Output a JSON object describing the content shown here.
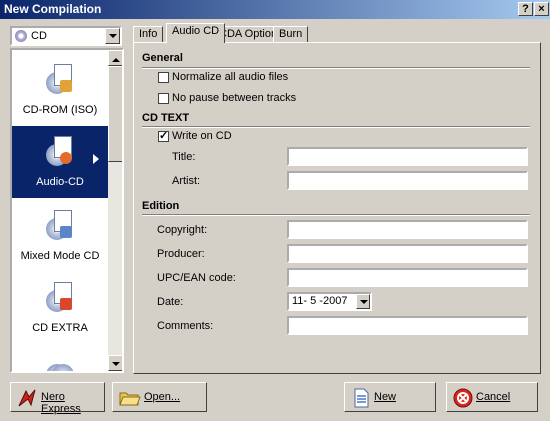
{
  "window": {
    "title": "New Compilation",
    "help_glyph": "?",
    "close_glyph": "×"
  },
  "dropdown": {
    "value": "CD",
    "icon": "cd-icon"
  },
  "types": [
    {
      "label": "CD-ROM (ISO)",
      "icon": "cdrom-iso-icon",
      "selected": false
    },
    {
      "label": "Audio-CD",
      "icon": "audio-cd-icon",
      "selected": true
    },
    {
      "label": "Mixed Mode CD",
      "icon": "mixed-mode-cd-icon",
      "selected": false
    },
    {
      "label": "CD EXTRA",
      "icon": "cd-extra-icon",
      "selected": false
    },
    {
      "label": "",
      "icon": "more-cd-icon",
      "selected": false
    }
  ],
  "tabs": [
    {
      "label": "Info",
      "active": false
    },
    {
      "label": "Audio CD",
      "active": true
    },
    {
      "label": "CDA Options",
      "active": false
    },
    {
      "label": "Burn",
      "active": false
    }
  ],
  "general": {
    "heading": "General",
    "normalize": {
      "label": "Normalize all audio files",
      "checked": false
    },
    "nopause": {
      "label": "No pause between tracks",
      "checked": false
    }
  },
  "cdtext": {
    "heading": "CD TEXT",
    "write": {
      "label": "Write on CD",
      "checked": true
    },
    "title_label": "Title:",
    "title_value": "",
    "artist_label": "Artist:",
    "artist_value": ""
  },
  "edition": {
    "heading": "Edition",
    "copyright_label": "Copyright:",
    "copyright_value": "",
    "producer_label": "Producer:",
    "producer_value": "",
    "upc_label": "UPC/EAN code:",
    "upc_value": "",
    "date_label": "Date:",
    "date_value": "11- 5 -2007",
    "comments_label": "Comments:",
    "comments_value": ""
  },
  "buttons": {
    "nero_express": "Nero Express",
    "open": "Open...",
    "new": "New",
    "cancel": "Cancel"
  }
}
